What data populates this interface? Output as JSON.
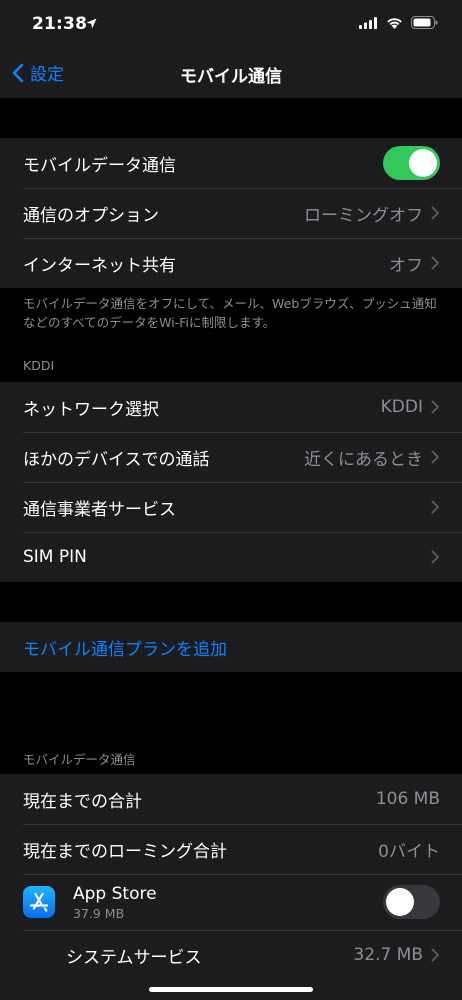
{
  "status_bar": {
    "time": "21:38"
  },
  "nav": {
    "back_label": "設定",
    "title": "モバイル通信"
  },
  "group1": {
    "mobile_data": {
      "label": "モバイルデータ通信",
      "toggle": "on"
    },
    "options": {
      "label": "通信のオプション",
      "value": "ローミングオフ"
    },
    "hotspot": {
      "label": "インターネット共有",
      "value": "オフ"
    }
  },
  "footnote1": "モバイルデータ通信をオフにして、メール、Webブラウズ、プッシュ通知などのすべてのデータをWi-Fiに制限します。",
  "kddi_header": "KDDI",
  "group2": {
    "network": {
      "label": "ネットワーク選択",
      "value": "KDDI"
    },
    "other_devices": {
      "label": "ほかのデバイスでの通話",
      "value": "近くにあるとき"
    },
    "carrier_services": {
      "label": "通信事業者サービス"
    },
    "sim_pin": {
      "label": "SIM PIN"
    }
  },
  "add_plan": {
    "label": "モバイル通信プランを追加"
  },
  "usage_header": "モバイルデータ通信",
  "usage": {
    "total": {
      "label": "現在までの合計",
      "value": "106 MB"
    },
    "roaming": {
      "label": "現在までのローミング合計",
      "value": "0バイト"
    },
    "app_store": {
      "name": "App Store",
      "size": "37.9 MB",
      "toggle": "off"
    },
    "system_services": {
      "label": "システムサービス",
      "value": "32.7 MB"
    }
  },
  "colors": {
    "accent": "#0a84ff",
    "toggle_on": "#34c759",
    "background": "#000000",
    "cell": "#1c1c1e"
  },
  "icons": [
    "location-arrow-icon",
    "signal-icon",
    "wifi-icon",
    "battery-icon",
    "chevron-left-icon",
    "chevron-right-icon",
    "app-store-icon"
  ]
}
